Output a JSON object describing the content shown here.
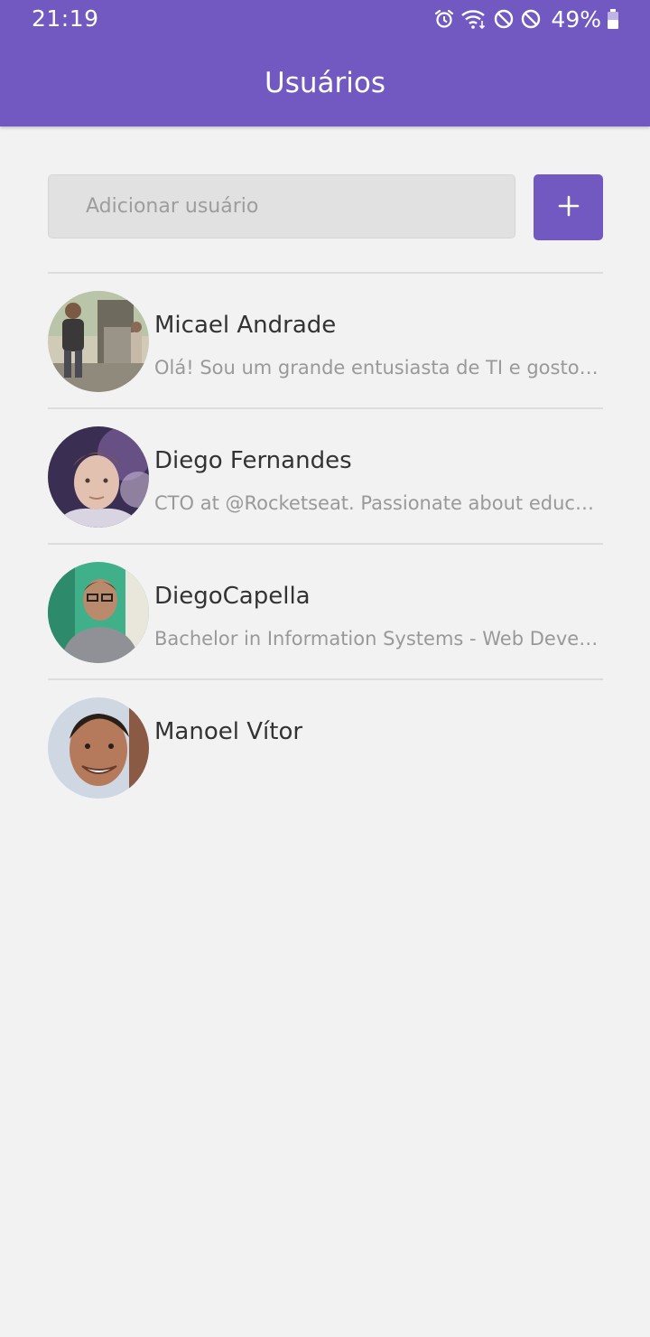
{
  "status_bar": {
    "time": "21:19",
    "battery_percent": "49%",
    "icons": [
      "alarm-icon",
      "wifi-icon",
      "do-not-disturb-icon",
      "blocked-icon",
      "battery-icon"
    ]
  },
  "header": {
    "title": "Usuários",
    "background_color": "#7159c1"
  },
  "form": {
    "input_placeholder": "Adicionar usuário",
    "input_value": "",
    "add_button_icon": "plus-icon",
    "add_button_color": "#7159c1"
  },
  "users": [
    {
      "name": "Micael Andrade",
      "bio": "Olá! Sou um grande entusiasta de TI e gosto d..."
    },
    {
      "name": "Diego Fernandes",
      "bio": "CTO at @Rocketseat. Passionate about educa..."
    },
    {
      "name": "DiegoCapella",
      "bio": "Bachelor in Information Systems - Web Devel..."
    },
    {
      "name": "Manoel Vítor",
      "bio": ""
    }
  ]
}
